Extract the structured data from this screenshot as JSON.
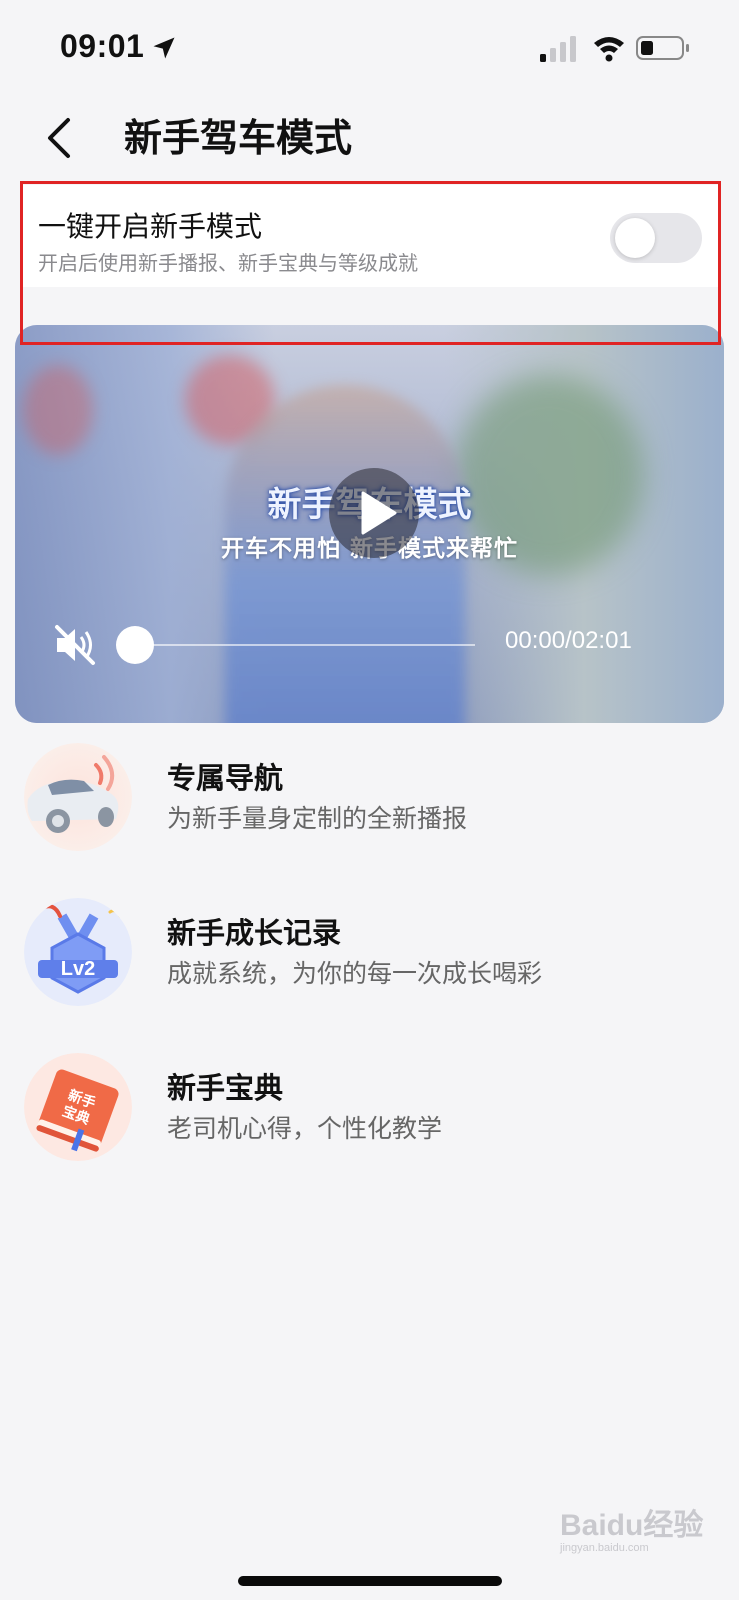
{
  "status_bar": {
    "time": "09:01",
    "icons": [
      "location-arrow-icon",
      "cellular-signal-icon",
      "wifi-icon",
      "battery-icon"
    ]
  },
  "header": {
    "back_icon": "chevron-left-icon",
    "title": "新手驾车模式"
  },
  "toggle_card": {
    "title": "一键开启新手模式",
    "subtitle": "开启后使用新手播报、新手宝典与等级成就",
    "enabled": false,
    "highlight_color": "#e02424"
  },
  "video": {
    "caption_title": "新手驾车模式",
    "caption_subtitle": "开车不用怕 新手模式来帮忙",
    "time_display": "00:00/02:01",
    "progress": 0,
    "muted": true
  },
  "features": [
    {
      "icon": "car-navigation-icon",
      "title": "专属导航",
      "desc": "为新手量身定制的全新播报"
    },
    {
      "icon": "level-medal-icon",
      "badge": "Lv2",
      "title": "新手成长记录",
      "desc": "成就系统，为你的每一次成长喝彩"
    },
    {
      "icon": "guide-book-icon",
      "badge": "新手宝典",
      "title": "新手宝典",
      "desc": "老司机心得，个性化教学"
    }
  ],
  "watermark": {
    "text": "Baidu经验",
    "sub": "jingyan.baidu.com"
  }
}
